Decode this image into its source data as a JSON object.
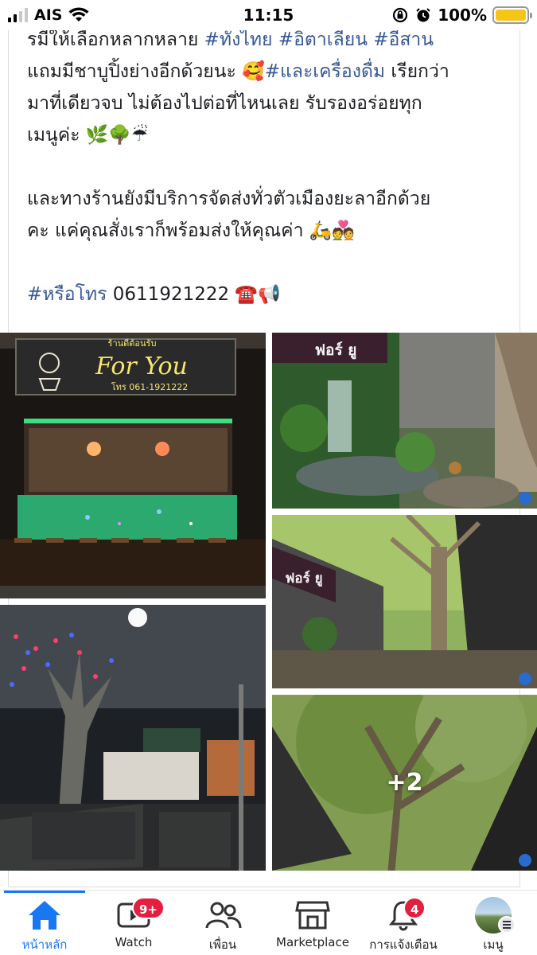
{
  "status_bar": {
    "carrier": "AIS",
    "time": "11:15",
    "battery": "100%"
  },
  "post": {
    "lines": [
      {
        "parts": [
          {
            "t": "รมีให้เลือกหลากหลาย ",
            "tag": false
          },
          {
            "t": "#ทั้งไทย #อิตาเลียน #อีสาน",
            "tag": true
          }
        ]
      },
      {
        "parts": [
          {
            "t": "แถมมีชาบูปิ้งย่างอีกด้วยนะ 🥰",
            "tag": false
          },
          {
            "t": "#และเครื่องดื่ม",
            "tag": true
          },
          {
            "t": " เรียกว่า",
            "tag": false
          }
        ]
      },
      {
        "parts": [
          {
            "t": "มาที่เดียวจบ ไม่ต้องไปต่อที่ไหนเลย รับรองอร่อยทุก",
            "tag": false
          }
        ]
      },
      {
        "parts": [
          {
            "t": "เมนูค่ะ 🌿🌳☔",
            "tag": false
          }
        ]
      },
      {
        "gap": true
      },
      {
        "parts": [
          {
            "t": "และทางร้านยังมีบริการจัดส่งทั่วตัวเมืองยะลาอีกด้วย",
            "tag": false
          }
        ]
      },
      {
        "parts": [
          {
            "t": "คะ แค่คุณสั่งเราก็พร้อมส่งให้คุณค่า 🛵💑",
            "tag": false
          }
        ]
      },
      {
        "gap": true
      },
      {
        "parts": [
          {
            "t": "#หรือโทร",
            "tag": true
          },
          {
            "t": " 0611921222 ☎️📢",
            "tag": false
          }
        ]
      }
    ],
    "photos": {
      "photo1_sign_title": "For You",
      "photo1_sign_small": "ร้านดีต้อนรับ",
      "photo1_sign_phone": "โทร 061-1921222",
      "photo2_sign": "ฟอร์ ยู",
      "photo4_sign": "ฟอร์ ยู",
      "more_count": "+2"
    }
  },
  "tabbar": {
    "tabs": [
      {
        "label": "หน้าหลัก",
        "icon": "home-icon",
        "active": true
      },
      {
        "label": "Watch",
        "icon": "watch-video-icon",
        "badge": "9+"
      },
      {
        "label": "เพื่อน",
        "icon": "friends-icon"
      },
      {
        "label": "Marketplace",
        "icon": "marketplace-shop-icon"
      },
      {
        "label": "การแจ้งเตือน",
        "icon": "bell-icon",
        "badge": "4"
      },
      {
        "label": "เมนู",
        "icon": "profile-avatar-icon"
      }
    ]
  },
  "colors": {
    "hashtag": "#385898",
    "active_tab": "#1877f2",
    "badge": "#e41e3f",
    "battery": "#f5c518"
  }
}
